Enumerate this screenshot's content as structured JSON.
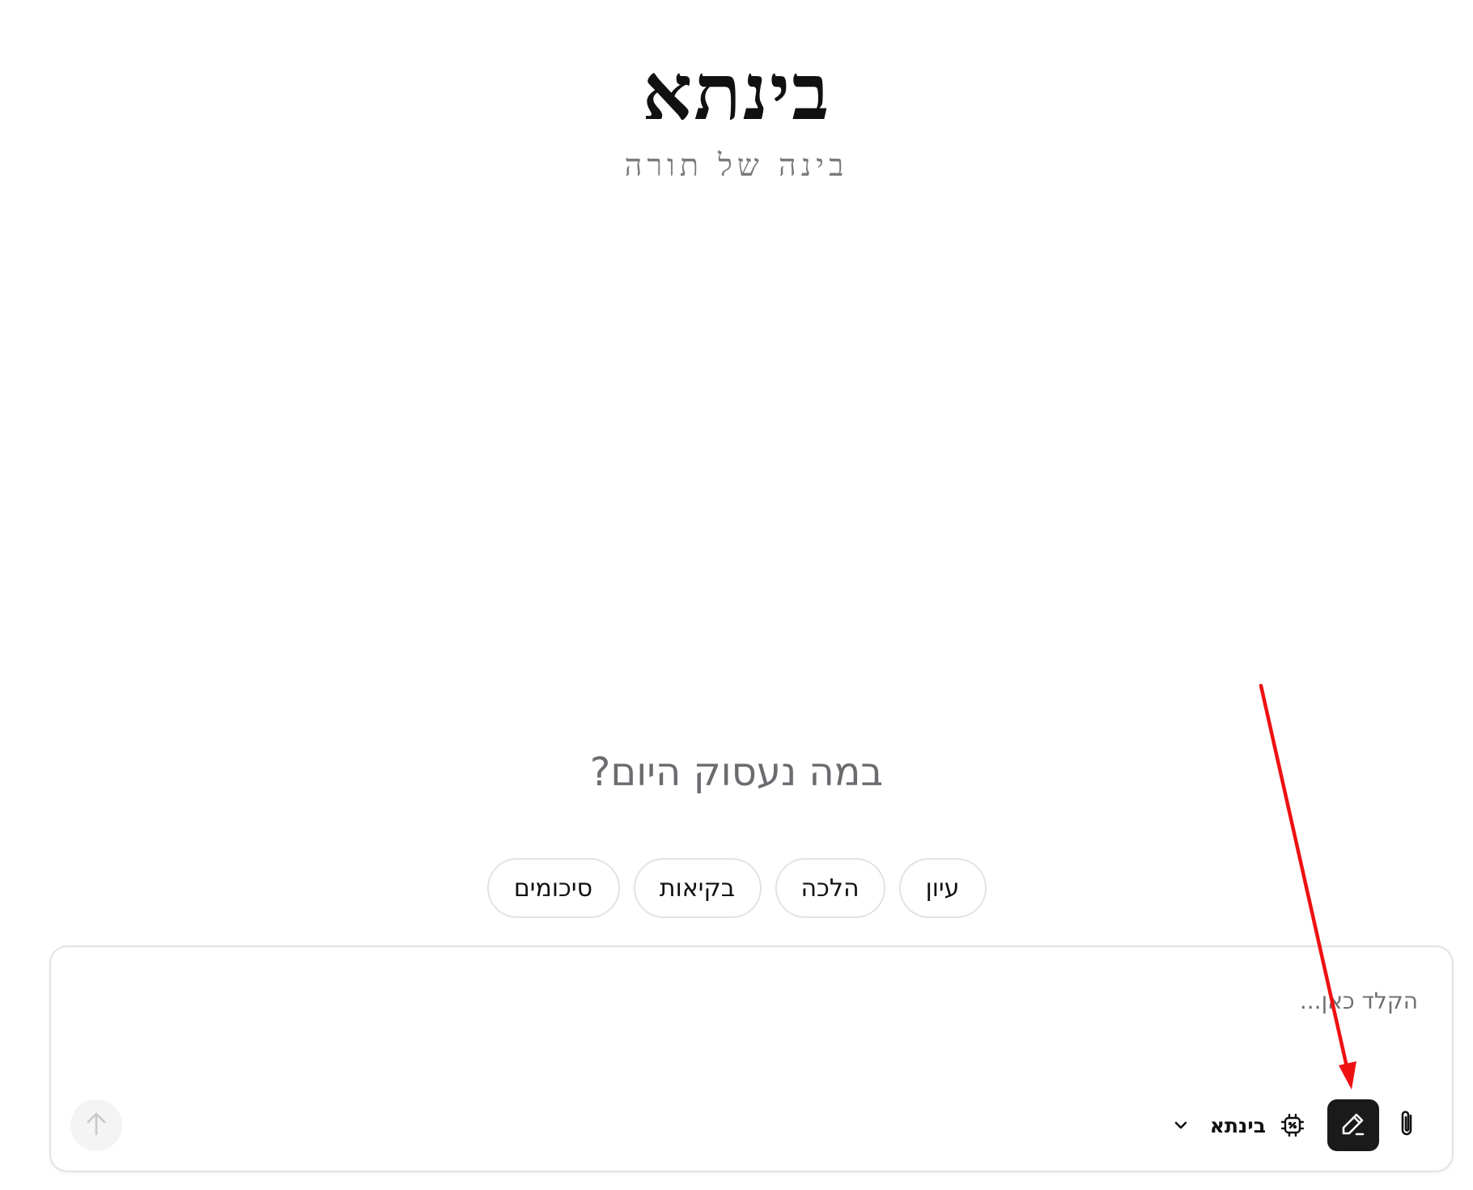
{
  "brand": {
    "title": "בינתא",
    "subtitle": "בינה של תורה"
  },
  "main": {
    "heading": "במה נעסוק היום?",
    "chips": [
      {
        "label": "עיון"
      },
      {
        "label": "הלכה"
      },
      {
        "label": "בקיאות"
      },
      {
        "label": "סיכומים"
      }
    ]
  },
  "composer": {
    "placeholder": "הקלד כאן...",
    "model_label": "בינתא",
    "icons": {
      "attach": "paperclip-icon",
      "edit": "pencil-icon",
      "model": "cpu-chip-icon",
      "chevron": "chevron-down-icon",
      "send": "arrow-up-icon"
    }
  },
  "colors": {
    "edit_button_bg": "#1a1a1a",
    "annotation_arrow": "#ee1111",
    "send_button_bg": "#f4f4f4"
  }
}
